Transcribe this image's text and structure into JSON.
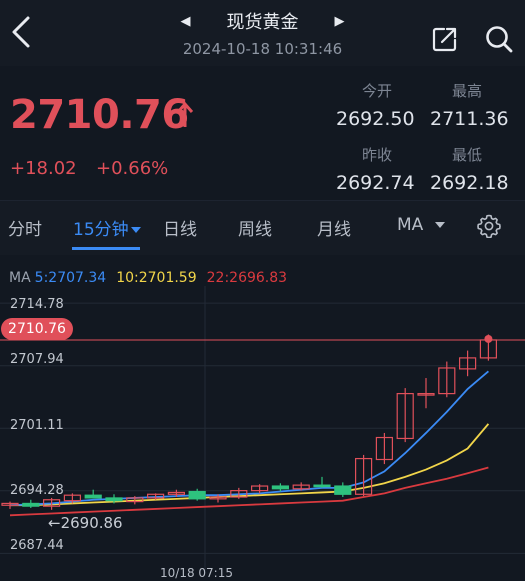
{
  "header": {
    "title": "现货黄金",
    "datetime": "2024-10-18 10:31:46",
    "prev_symbol_icon": "triangle-left-icon",
    "next_symbol_icon": "triangle-right-icon"
  },
  "quote": {
    "price": "2710.76",
    "change": "+18.02",
    "change_pct": "+0.66%",
    "open_label": "今开",
    "open": "2692.50",
    "high_label": "最高",
    "high": "2711.36",
    "prev_close_label": "昨收",
    "prev_close": "2692.74",
    "low_label": "最低",
    "low": "2692.18"
  },
  "tabs": {
    "items": [
      "分时",
      "15分钟",
      "日线",
      "周线",
      "月线",
      "MA"
    ],
    "active": "15分钟"
  },
  "chart": {
    "ma_prefix": "MA",
    "ma5": "5:2707.34",
    "ma10": "10:2701.59",
    "ma22": "22:2696.83",
    "y_ticks": [
      "2714.78",
      "2707.94",
      "2701.11",
      "2694.28",
      "2687.44"
    ],
    "current_price_tag": "2710.76",
    "min_marker": "←2690.86",
    "x_tick": "10/18 07:15",
    "colors": {
      "up": "#e0505a",
      "down": "#2ec27e",
      "ma5": "#3b8bf5",
      "ma10": "#f1d54a",
      "ma22": "#d93a3f"
    }
  },
  "chart_data": {
    "type": "candlestick",
    "ylim": [
      2686.5,
      2716.0
    ],
    "y_ticks": [
      2714.78,
      2707.94,
      2701.11,
      2694.28,
      2687.44
    ],
    "x_ticks": [
      "10/18 07:15"
    ],
    "candles": [
      {
        "o": 2692.7,
        "h": 2693.1,
        "l": 2692.3,
        "c": 2692.9
      },
      {
        "o": 2692.9,
        "h": 2693.3,
        "l": 2692.4,
        "c": 2692.6
      },
      {
        "o": 2692.6,
        "h": 2693.5,
        "l": 2692.2,
        "c": 2693.3
      },
      {
        "o": 2693.2,
        "h": 2694.0,
        "l": 2692.9,
        "c": 2693.8
      },
      {
        "o": 2693.8,
        "h": 2694.4,
        "l": 2693.5,
        "c": 2693.5
      },
      {
        "o": 2693.5,
        "h": 2693.9,
        "l": 2692.9,
        "c": 2693.2
      },
      {
        "o": 2693.1,
        "h": 2693.7,
        "l": 2692.8,
        "c": 2693.5
      },
      {
        "o": 2693.5,
        "h": 2694.0,
        "l": 2693.3,
        "c": 2693.9
      },
      {
        "o": 2693.9,
        "h": 2694.4,
        "l": 2693.6,
        "c": 2694.1
      },
      {
        "o": 2694.2,
        "h": 2694.5,
        "l": 2693.2,
        "c": 2693.4
      },
      {
        "o": 2693.4,
        "h": 2693.9,
        "l": 2693.0,
        "c": 2693.6
      },
      {
        "o": 2693.6,
        "h": 2694.6,
        "l": 2693.4,
        "c": 2694.3
      },
      {
        "o": 2694.3,
        "h": 2695.0,
        "l": 2694.0,
        "c": 2694.8
      },
      {
        "o": 2694.8,
        "h": 2695.1,
        "l": 2694.2,
        "c": 2694.5
      },
      {
        "o": 2694.5,
        "h": 2695.2,
        "l": 2694.3,
        "c": 2694.9
      },
      {
        "o": 2694.9,
        "h": 2695.8,
        "l": 2694.6,
        "c": 2694.8
      },
      {
        "o": 2694.8,
        "h": 2695.2,
        "l": 2693.6,
        "c": 2693.9
      },
      {
        "o": 2693.9,
        "h": 2698.2,
        "l": 2693.7,
        "c": 2697.8
      },
      {
        "o": 2697.7,
        "h": 2700.6,
        "l": 2697.2,
        "c": 2700.1
      },
      {
        "o": 2700.0,
        "h": 2705.5,
        "l": 2699.6,
        "c": 2704.9
      },
      {
        "o": 2704.9,
        "h": 2706.6,
        "l": 2703.3,
        "c": 2704.9
      },
      {
        "o": 2704.9,
        "h": 2708.4,
        "l": 2704.5,
        "c": 2707.7
      },
      {
        "o": 2707.6,
        "h": 2709.6,
        "l": 2706.8,
        "c": 2708.8
      },
      {
        "o": 2708.8,
        "h": 2711.36,
        "l": 2708.5,
        "c": 2710.76
      }
    ],
    "ma5": [
      2692.7,
      2692.8,
      2692.9,
      2693.1,
      2693.3,
      2693.4,
      2693.5,
      2693.6,
      2693.7,
      2693.8,
      2693.8,
      2693.9,
      2694.0,
      2694.2,
      2694.4,
      2694.6,
      2694.6,
      2695.2,
      2696.4,
      2698.4,
      2700.6,
      2702.9,
      2705.4,
      2707.34
    ],
    "ma10": [
      2692.7,
      2692.7,
      2692.8,
      2692.9,
      2693.0,
      2693.1,
      2693.2,
      2693.3,
      2693.4,
      2693.5,
      2693.6,
      2693.7,
      2693.8,
      2693.9,
      2694.0,
      2694.1,
      2694.2,
      2694.6,
      2695.1,
      2695.8,
      2696.6,
      2697.6,
      2698.9,
      2701.59
    ],
    "ma22": [
      2691.6,
      2691.7,
      2691.8,
      2691.9,
      2692.0,
      2692.1,
      2692.2,
      2692.3,
      2692.4,
      2692.5,
      2692.6,
      2692.7,
      2692.8,
      2692.9,
      2693.0,
      2693.1,
      2693.2,
      2693.6,
      2694.0,
      2694.6,
      2695.1,
      2695.6,
      2696.2,
      2696.83
    ]
  }
}
